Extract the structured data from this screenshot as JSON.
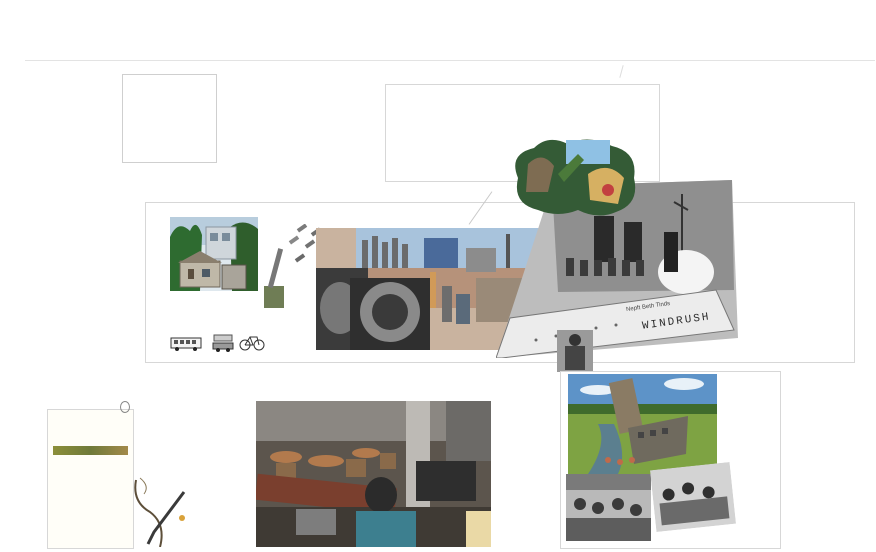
{
  "canvas": {
    "background": "#ffffff",
    "frame_border_color": "#d7d7d7"
  },
  "collage": {
    "ship_name": "WINDRUSH",
    "ship_registry": "Nepft Beth Tinds"
  },
  "icons": {
    "bicycle": "bicycle-icon",
    "bus": "bus-icon",
    "car": "car-icon"
  }
}
